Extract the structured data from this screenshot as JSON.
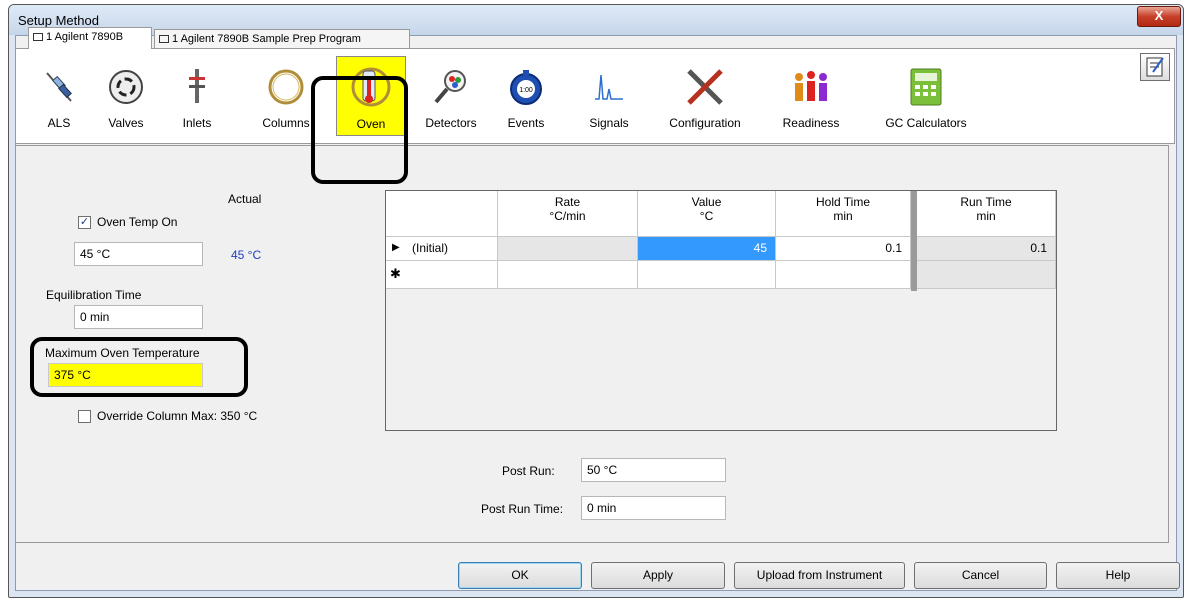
{
  "window": {
    "title": "Setup Method",
    "close_symbol": "X"
  },
  "tabs": [
    {
      "label": "1 Agilent 7890B",
      "active": true
    },
    {
      "label": "1 Agilent 7890B Sample Prep Program",
      "active": false
    }
  ],
  "toolbar": {
    "items": [
      {
        "label": "ALS",
        "icon": "syringe-icon"
      },
      {
        "label": "Valves",
        "icon": "valve-icon"
      },
      {
        "label": "Inlets",
        "icon": "inlet-icon"
      },
      {
        "label": "Columns",
        "icon": "column-icon"
      },
      {
        "label": "Oven",
        "icon": "thermometer-icon",
        "selected": true
      },
      {
        "label": "Detectors",
        "icon": "detector-icon"
      },
      {
        "label": "Events",
        "icon": "stopwatch-icon",
        "icon_text": "1:00"
      },
      {
        "label": "Signals",
        "icon": "signal-icon"
      },
      {
        "label": "Configuration",
        "icon": "tools-icon"
      },
      {
        "label": "Readiness",
        "icon": "readiness-icon"
      },
      {
        "label": "GC Calculators",
        "icon": "calculator-icon"
      }
    ]
  },
  "oven": {
    "actual_label": "Actual",
    "oven_temp_on_label": "Oven Temp On",
    "oven_temp_on_checked": true,
    "oven_temp_value": "45 °C",
    "oven_temp_actual": "45 °C",
    "equilibration_label": "Equilibration Time",
    "equilibration_value": "0 min",
    "max_temp_label": "Maximum Oven Temperature",
    "max_temp_value": "375 °C",
    "override_label": "Override Column Max: 350 °C",
    "override_checked": false,
    "post_run_label": "Post Run:",
    "post_run_value": "50 °C",
    "post_run_time_label": "Post Run Time:",
    "post_run_time_value": "0 min"
  },
  "grid": {
    "columns": [
      {
        "title": "Rate",
        "unit": "°C/min"
      },
      {
        "title": "Value",
        "unit": "°C"
      },
      {
        "title": "Hold Time",
        "unit": "min"
      },
      {
        "title": "Run Time",
        "unit": "min"
      }
    ],
    "rows": [
      {
        "marker": "▶",
        "label": "(Initial)",
        "rate": "",
        "value": "45",
        "hold": "0.1",
        "run": "0.1"
      }
    ],
    "new_row_marker": "✱"
  },
  "buttons": {
    "ok": "OK",
    "apply": "Apply",
    "upload": "Upload from Instrument",
    "cancel": "Cancel",
    "help": "Help"
  },
  "colors": {
    "highlight": "#ffff00",
    "selected_cell": "#3399ff",
    "actual_text": "#1f3dbf"
  }
}
